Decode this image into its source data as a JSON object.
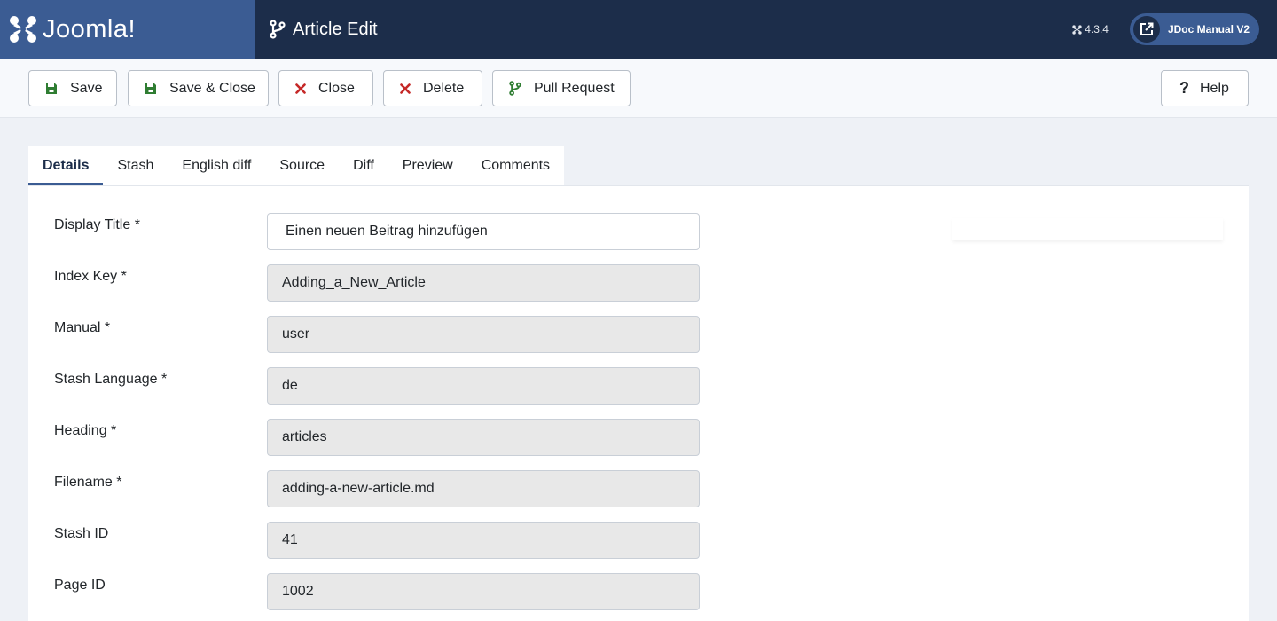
{
  "header": {
    "brand": "Joomla!",
    "page_title": "Article Edit",
    "version": "4.3.4",
    "site_button": "JDoc Manual V2",
    "colors": {
      "bar": "#1c2d4a",
      "brand_block": "#3b5c93"
    }
  },
  "toolbar": {
    "save": "Save",
    "save_close": "Save & Close",
    "close": "Close",
    "delete": "Delete",
    "pull_request": "Pull Request",
    "help": "Help",
    "icons": {
      "save": "floppy-icon",
      "close": "x-icon",
      "delete": "x-icon",
      "pull_request": "branch-icon",
      "help": "question-icon"
    },
    "colors": {
      "danger": "#c52827",
      "success": "#2f7d32"
    }
  },
  "tabs": [
    {
      "label": "Details",
      "active": true
    },
    {
      "label": "Stash",
      "active": false
    },
    {
      "label": "English diff",
      "active": false
    },
    {
      "label": "Source",
      "active": false
    },
    {
      "label": "Diff",
      "active": false
    },
    {
      "label": "Preview",
      "active": false
    },
    {
      "label": "Comments",
      "active": false
    }
  ],
  "form": {
    "display_title": {
      "label": "Display Title *",
      "value": "Einen neuen Beitrag hinzufügen"
    },
    "index_key": {
      "label": "Index Key *",
      "value": "Adding_a_New_Article"
    },
    "manual": {
      "label": "Manual *",
      "value": "user"
    },
    "stash_language": {
      "label": "Stash Language *",
      "value": "de"
    },
    "heading": {
      "label": "Heading *",
      "value": "articles"
    },
    "filename": {
      "label": "Filename *",
      "value": "adding-a-new-article.md"
    },
    "stash_id": {
      "label": "Stash ID",
      "value": "41"
    },
    "page_id": {
      "label": "Page ID",
      "value": "1002"
    }
  }
}
